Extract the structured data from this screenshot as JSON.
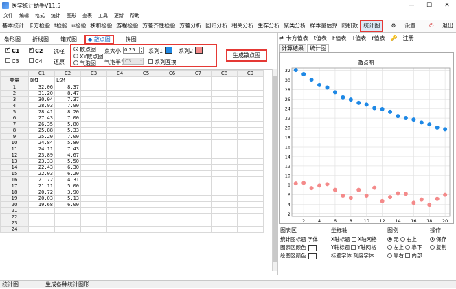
{
  "window": {
    "title": "医学统计助手V11.5",
    "minimize": "—",
    "maximize": "☐",
    "close": "✕"
  },
  "menu": [
    "文件",
    "编辑",
    "格式",
    "统计",
    "图形",
    "查表",
    "工具",
    "更新",
    "帮助"
  ],
  "toolbar": {
    "items": [
      "基本统计",
      "卡方检验",
      "t检验",
      "u检验",
      "秩和检验",
      "游程检验",
      "方差齐性检验",
      "方差分析",
      "回归分析",
      "相关分析",
      "生存分析",
      "聚类分析",
      "样本量估算",
      "随机数",
      "统计图"
    ],
    "active": "统计图",
    "settings": "设置",
    "exit": "退出"
  },
  "chart_tabs": {
    "items": [
      "条形图",
      "折线图",
      "箱式图"
    ],
    "selected": "◆ 散点图",
    "last": "饼图"
  },
  "left_controls": {
    "c1": "C1",
    "c2": "C2",
    "c3": "C3",
    "c4": "C4",
    "select": "选择",
    "restore": "还原"
  },
  "scatter_options": {
    "radio1": "散点图",
    "radio2": "XY散点图",
    "radio3": "气泡图",
    "point_size_label": "点大小",
    "point_size": "0.25",
    "series1_label": "系列1",
    "series2_label": "系列2",
    "bubble_label": "气泡半径",
    "bubble_value": "C3",
    "swap_label": "系列互换",
    "series1_color": "#1e88e5",
    "series2_color": "#f48a8a"
  },
  "generate_button": "生成散点图",
  "grid": {
    "columns": [
      "C1",
      "C2",
      "C3",
      "C4",
      "C5",
      "C6",
      "C7",
      "C8",
      "C9"
    ],
    "row_header_label": "变量",
    "var_names": [
      "BMI",
      "LSM"
    ],
    "rows": [
      [
        "32.06",
        "8.37"
      ],
      [
        "31.20",
        "8.47"
      ],
      [
        "30.04",
        "7.37"
      ],
      [
        "28.93",
        "7.90"
      ],
      [
        "28.41",
        "8.20"
      ],
      [
        "27.43",
        "7.00"
      ],
      [
        "26.35",
        "5.80"
      ],
      [
        "25.88",
        "5.33"
      ],
      [
        "25.20",
        "7.00"
      ],
      [
        "24.84",
        "5.80"
      ],
      [
        "24.11",
        "7.43"
      ],
      [
        "23.89",
        "4.67"
      ],
      [
        "23.33",
        "5.50"
      ],
      [
        "22.43",
        "6.30"
      ],
      [
        "22.03",
        "6.20"
      ],
      [
        "21.72",
        "4.31"
      ],
      [
        "21.11",
        "5.00"
      ],
      [
        "20.72",
        "3.90"
      ],
      [
        "20.03",
        "5.13"
      ],
      [
        "19.68",
        "6.00"
      ],
      [
        "",
        ""
      ],
      [
        "",
        ""
      ],
      [
        "",
        ""
      ],
      [
        "",
        ""
      ]
    ]
  },
  "right_top": [
    "卡方值表",
    "t值表",
    "F值表",
    "T值表",
    "r值表",
    "注册"
  ],
  "right_tabs": [
    "计算结果",
    "统计图"
  ],
  "chart_data": {
    "type": "scatter",
    "title": "散点图",
    "x": [
      1,
      2,
      3,
      4,
      5,
      6,
      7,
      8,
      9,
      10,
      11,
      12,
      13,
      14,
      15,
      16,
      17,
      18,
      19,
      20
    ],
    "series": [
      {
        "values": [
          32.06,
          31.2,
          30.04,
          28.93,
          28.41,
          27.43,
          26.35,
          25.88,
          25.2,
          24.84,
          24.11,
          23.89,
          23.33,
          22.43,
          22.03,
          21.72,
          21.11,
          20.72,
          20.03,
          19.68
        ]
      },
      {
        "values": [
          8.37,
          8.47,
          7.37,
          7.9,
          8.2,
          7.0,
          5.8,
          5.33,
          7.0,
          5.8,
          7.43,
          4.67,
          5.5,
          6.3,
          6.2,
          4.31,
          5.0,
          3.9,
          5.13,
          6.0
        ]
      }
    ],
    "xticks": [
      2,
      4,
      6,
      8,
      10,
      12,
      14,
      16,
      18,
      20
    ],
    "yticks": [
      2,
      4,
      6,
      8,
      10,
      12,
      14,
      16,
      18,
      20,
      22,
      24,
      26,
      28,
      30,
      32
    ],
    "xlim": [
      0.5,
      20.6
    ],
    "ylim": [
      1.5,
      32.5
    ],
    "grid": true
  },
  "chart_controls": {
    "area": {
      "title": "图表区",
      "r1": "统计图标题",
      "r1b": "字体",
      "r2": "图表区颜色",
      "r3": "绘图区颜色"
    },
    "axes": {
      "title": "坐标轴",
      "x_title": "X轴标题",
      "x_grid": "X轴网格",
      "y_title": "Y轴标题",
      "y_grid": "Y轴网格",
      "title_font": "标题字体",
      "tick_font": "刻度字体"
    },
    "legend": {
      "title": "图例",
      "none": "无",
      "top_right": "右上",
      "top_left": "左上",
      "bottom": "靠下",
      "right": "靠右",
      "inner": "内部"
    },
    "ops": {
      "title": "操作",
      "save": "保存",
      "copy": "复制"
    }
  },
  "status": {
    "left": "统计图",
    "right": "生成各种统计图形"
  }
}
